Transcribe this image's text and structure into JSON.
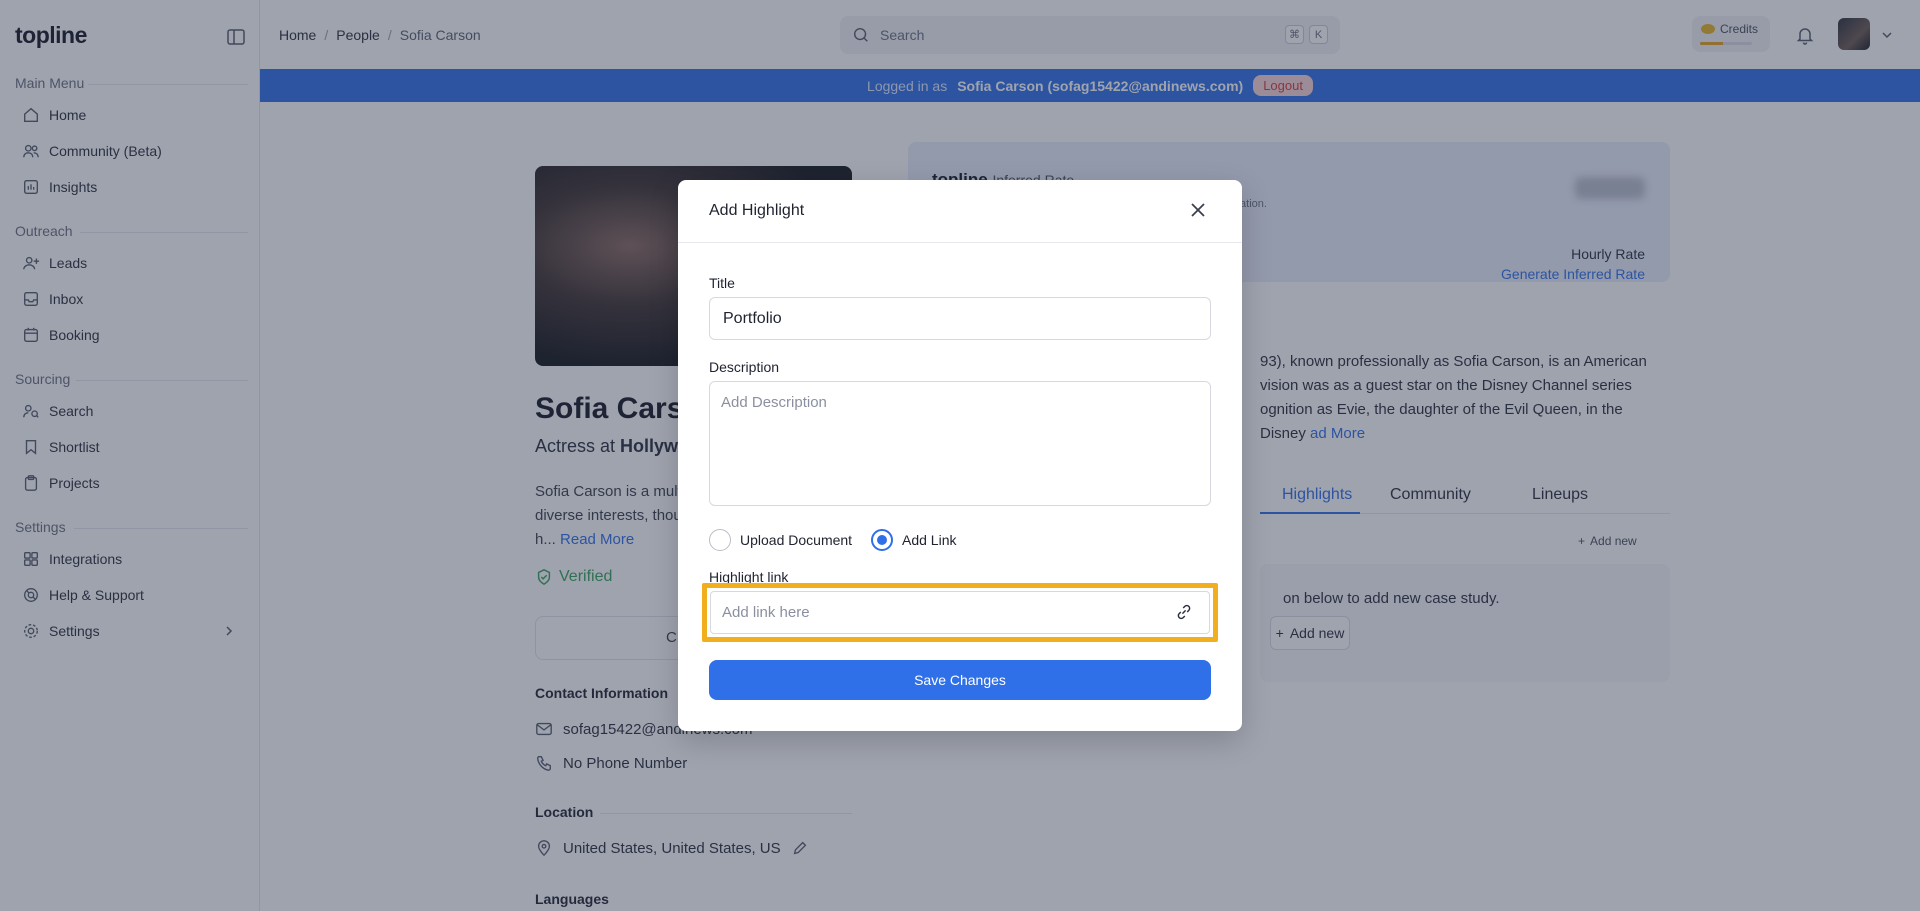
{
  "app": {
    "logo": "topline"
  },
  "sidebar": {
    "sections": [
      {
        "label": "Main Menu"
      },
      {
        "label": "Outreach"
      },
      {
        "label": "Sourcing"
      },
      {
        "label": "Settings"
      }
    ],
    "items": [
      {
        "label": "Home",
        "icon": "home-icon"
      },
      {
        "label": "Community (Beta)",
        "icon": "users-icon"
      },
      {
        "label": "Insights",
        "icon": "chart-icon"
      },
      {
        "label": "Leads",
        "icon": "user-plus-icon"
      },
      {
        "label": "Inbox",
        "icon": "inbox-icon"
      },
      {
        "label": "Booking",
        "icon": "calendar-icon"
      },
      {
        "label": "Search",
        "icon": "search-icon"
      },
      {
        "label": "Shortlist",
        "icon": "bookmark-icon"
      },
      {
        "label": "Projects",
        "icon": "clipboard-icon"
      },
      {
        "label": "Integrations",
        "icon": "grid-icon"
      },
      {
        "label": "Help & Support",
        "icon": "help-icon"
      },
      {
        "label": "Settings",
        "icon": "gear-icon"
      }
    ]
  },
  "header": {
    "breadcrumb": [
      "Home",
      "People",
      "Sofia Carson"
    ],
    "search_placeholder": "Search",
    "shortcut_keys": [
      "⌘",
      "K"
    ],
    "credits_label": "Credits",
    "credits_level": 0.45
  },
  "banner": {
    "prefix": "Logged in as",
    "user": "Sofia Carson (sofag15422@andinews.com)",
    "logout": "Logout"
  },
  "profile": {
    "name": "Sofia Cars",
    "role_prefix": "Actress at",
    "role_company": "Hollyw",
    "bio": "Sofia Carson is a mult diverse interests, thou h...",
    "read_more": "Read More",
    "verified": "Verified",
    "connect_btn": "C",
    "contact_title": "Contact Information",
    "email": "sofag15422@andinews.com",
    "phone": "No Phone Number",
    "location_title": "Location",
    "location": "United States, United States, US",
    "languages_title": "Languages"
  },
  "rate": {
    "brand": "topline",
    "label": "Inferred Rate",
    "sub": "aboration.",
    "hourly": "Hourly Rate",
    "generate": "Generate Inferred Rate"
  },
  "about": {
    "text": "93), known professionally as Sofia Carson, is an American vision was as a guest star on the Disney Channel series ognition as Evie, the daughter of the Evil Queen, in the Disney",
    "read_more": "ad More"
  },
  "tabs": [
    {
      "label": "Highlights",
      "active": true
    },
    {
      "label": "Community",
      "active": false
    },
    {
      "label": "Lineups",
      "active": false
    }
  ],
  "highlights": {
    "add_new_top": "Add new",
    "empty_text": "on below to add new case study.",
    "add_new_btn": "Add new"
  },
  "modal": {
    "title": "Add Highlight",
    "title_label": "Title",
    "title_value": "Portfolio",
    "description_label": "Description",
    "description_placeholder": "Add Description",
    "option_upload": "Upload Document",
    "option_link": "Add Link",
    "link_label": "Highlight link",
    "link_placeholder": "Add link here",
    "save": "Save Changes"
  },
  "colors": {
    "accent": "#2f6fe8",
    "highlight_frame": "#f1ae1d",
    "verified": "#3aa35a",
    "logout": "#d33b3b"
  }
}
